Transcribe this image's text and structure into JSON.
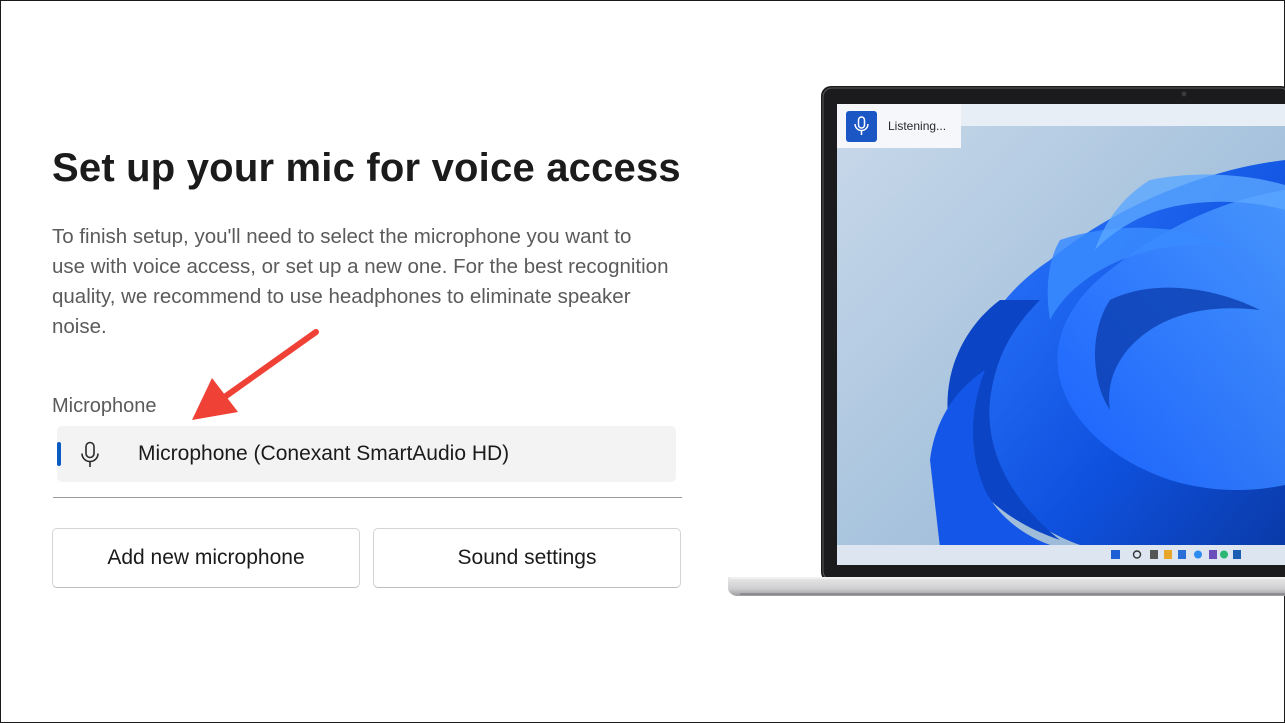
{
  "page": {
    "title": "Set up your mic for voice access",
    "description_lines": [
      "To finish setup, you'll need to select the microphone you want to",
      "use with voice access, or set up a new one. For the best recognition",
      "quality, we recommend to use headphones to eliminate speaker",
      "noise."
    ]
  },
  "microphone": {
    "label": "Microphone",
    "selected": "Microphone (Conexant SmartAudio HD)",
    "icon": "microphone-icon"
  },
  "buttons": {
    "add_label": "Add new microphone",
    "sound_label": "Sound settings"
  },
  "preview": {
    "voice_status": "Listening...",
    "voice_icon": "microphone-icon"
  },
  "colors": {
    "accent": "#0b5cc2",
    "arrow": "#ef4136",
    "voice_badge": "#1a56c4"
  }
}
